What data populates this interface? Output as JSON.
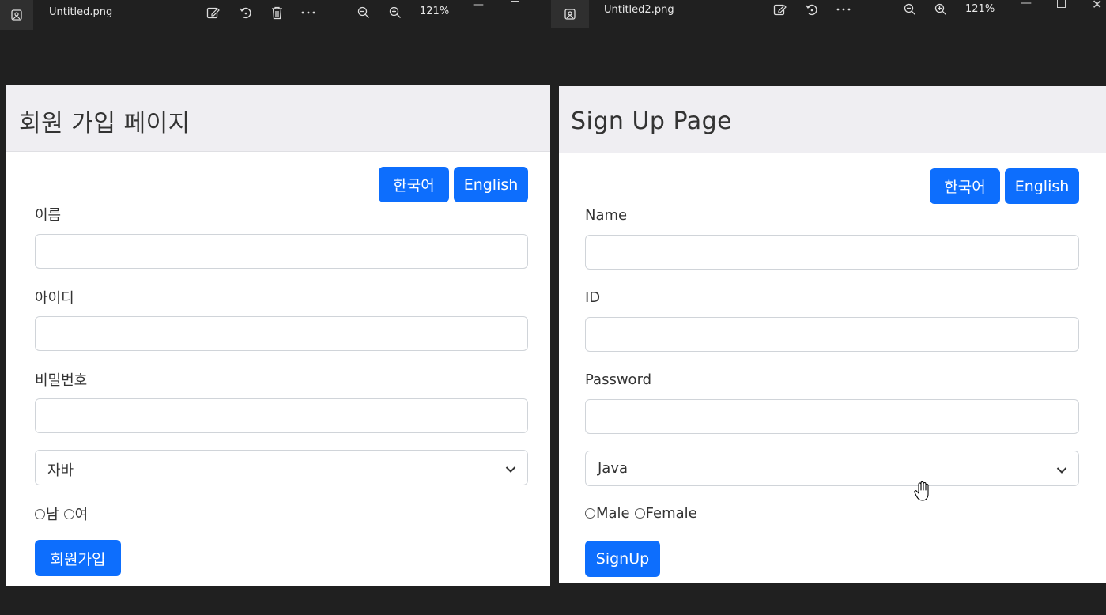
{
  "viewers": [
    {
      "file_name": "Untitled.png",
      "zoom": "121%",
      "page": {
        "title": "회원 가입 페이지",
        "lang_korean": "한국어",
        "lang_english": "English",
        "name_label": "이름",
        "id_label": "아이디",
        "password_label": "비밀번호",
        "select_value": "자바",
        "gender_male": "남",
        "gender_female": "여",
        "submit_label": "회원가입"
      }
    },
    {
      "file_name": "Untitled2.png",
      "zoom": "121%",
      "page": {
        "title": "Sign Up Page",
        "lang_korean": "한국어",
        "lang_english": "English",
        "name_label": "Name",
        "id_label": "ID",
        "password_label": "Password",
        "select_value": "Java",
        "gender_male": "Male",
        "gender_female": "Female",
        "submit_label": "SignUp"
      }
    }
  ],
  "colors": {
    "primary_button": "#0d6efd",
    "header_bg": "#efeef2",
    "window_bg": "#202020"
  },
  "icons": [
    "image-icon",
    "edit-icon",
    "rotate-icon",
    "delete-icon",
    "more-icon",
    "zoom-out-icon",
    "zoom-in-icon",
    "minimize-icon",
    "maximize-icon",
    "close-icon",
    "chevron-down-icon",
    "hand-cursor-icon"
  ]
}
